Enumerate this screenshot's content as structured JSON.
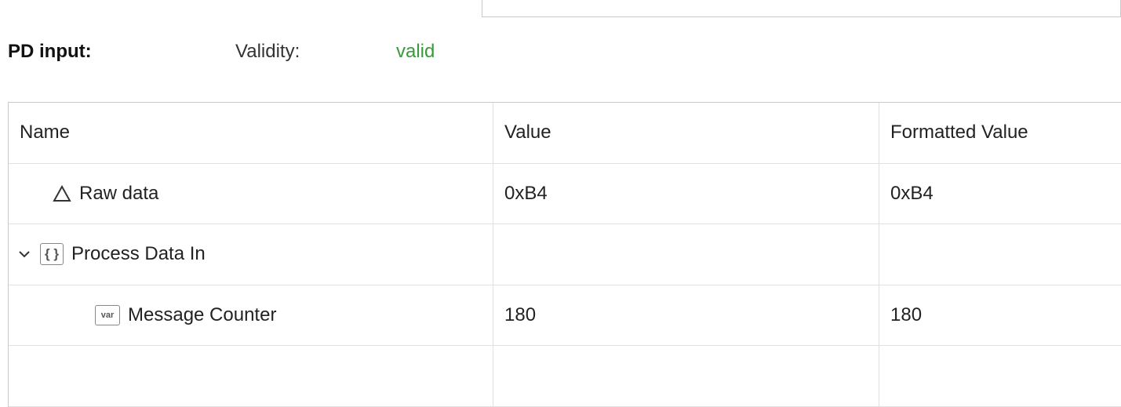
{
  "header": {
    "title": "PD input:",
    "validity_label": "Validity:",
    "validity_value": "valid"
  },
  "columns": {
    "name": "Name",
    "value": "Value",
    "formatted": "Formatted Value"
  },
  "rows": [
    {
      "name": "Raw data",
      "value": "0xB4",
      "formatted": "0xB4",
      "icon": "triangle",
      "indent": 1,
      "expand": null
    },
    {
      "name": "Process Data In",
      "value": "",
      "formatted": "",
      "icon": "braces",
      "indent": 0,
      "expand": "down"
    },
    {
      "name": "Message Counter",
      "value": "180",
      "formatted": "180",
      "icon": "var",
      "indent": 2,
      "expand": null
    }
  ],
  "icons": {
    "braces_glyph": "{ }",
    "var_glyph": "var"
  },
  "colors": {
    "valid": "#3a9a3a",
    "border": "#c9c9c9",
    "grid_line": "#e0e0e0"
  }
}
